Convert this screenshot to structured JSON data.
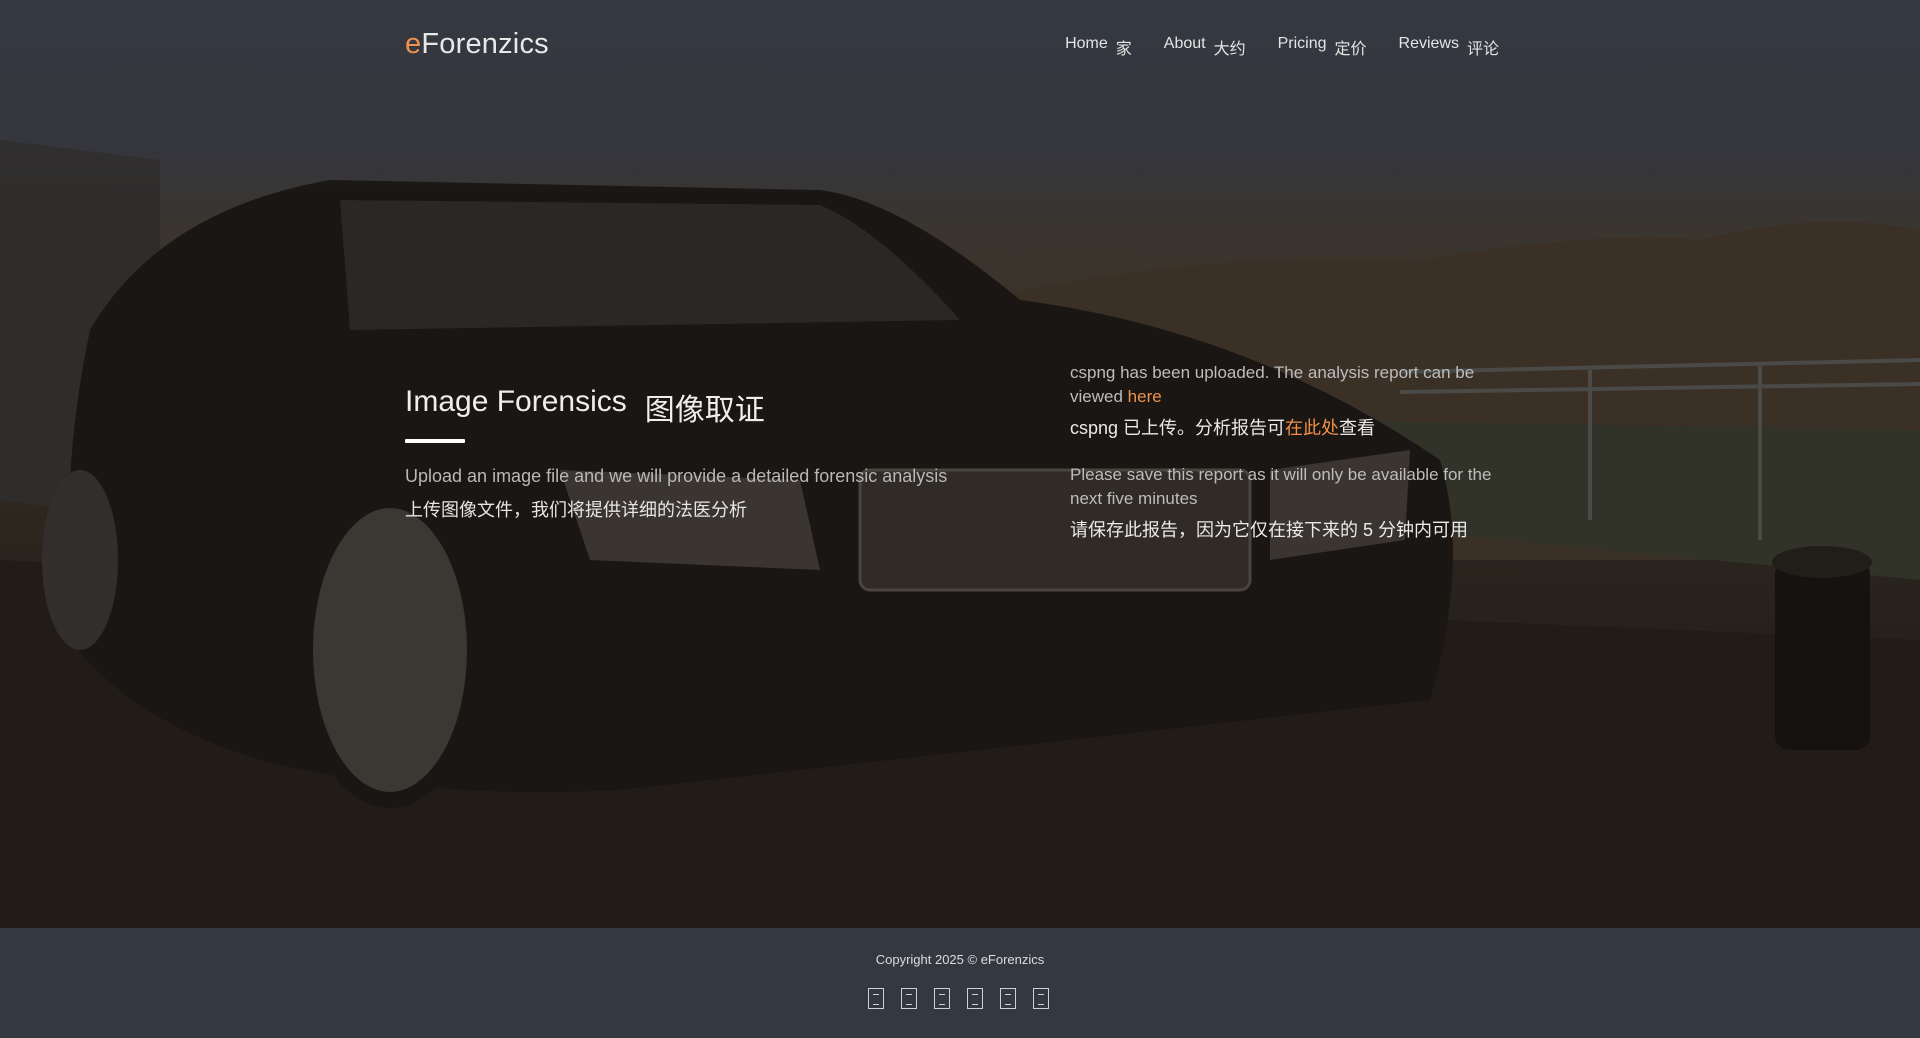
{
  "header": {
    "logo_accent": "e",
    "logo_rest": "Forenzics",
    "nav": [
      {
        "en": "Home",
        "zh": "家"
      },
      {
        "en": "About",
        "zh": "大约"
      },
      {
        "en": "Pricing",
        "zh": "定价"
      },
      {
        "en": "Reviews",
        "zh": "评论"
      }
    ]
  },
  "hero": {
    "title_en": "Image Forensics",
    "title_zh": "图像取证",
    "desc_en": "Upload an image file and we will provide a detailed forensic analysis",
    "desc_zh": "上传图像文件，我们将提供详细的法医分析"
  },
  "status": {
    "uploaded_en": "cspng has been uploaded. The analysis report can be viewed",
    "link_en": "here",
    "uploaded_zh_pre": "cspng 已上传。分析报告可",
    "link_zh": "在此处",
    "uploaded_zh_post": "查看",
    "save_en": "Please save this report as it will only be available for the next five minutes",
    "save_zh": "请保存此报告，因为它仅在接下来的 5 分钟内可用"
  },
  "footer": {
    "copyright": "Copyright 2025 © eForenzics",
    "social_icons": [
      "social-icon-1",
      "social-icon-2",
      "social-icon-3",
      "social-icon-4",
      "social-icon-5",
      "social-icon-6"
    ]
  },
  "colors": {
    "accent": "#f0904a",
    "footer_bg": "#343841"
  }
}
